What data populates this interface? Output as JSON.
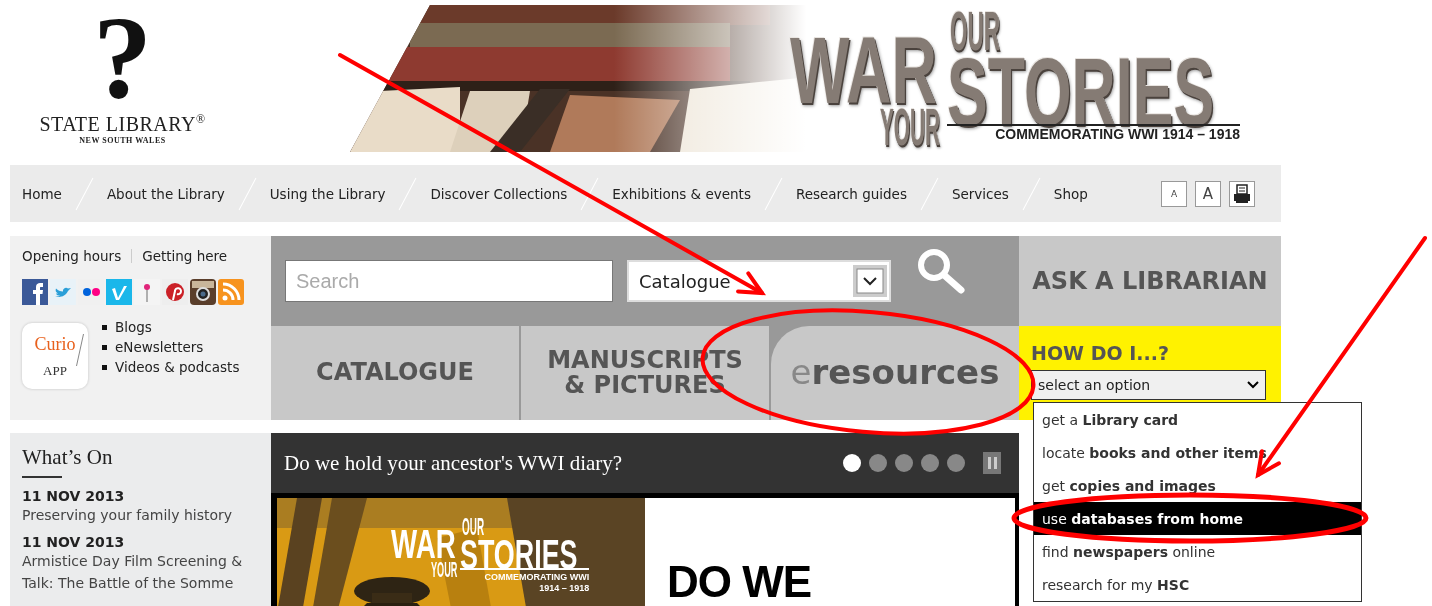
{
  "header": {
    "logo": {
      "mark": "?",
      "name": "STATE LIBRARY",
      "registered": "®",
      "subtitle": "NEW SOUTH WALES"
    },
    "banner": {
      "word_1": "WAR",
      "word_2": "YOUR",
      "word_3": "OUR",
      "word_4": "STORIES",
      "tagline": [
        "COMMEMORATING WWI 1914 – 1918"
      ]
    }
  },
  "nav": {
    "items": [
      "Home",
      "About the Library",
      "Using the Library",
      "Discover Collections",
      "Exhibitions & events",
      "Research guides",
      "Services",
      "Shop"
    ],
    "tools": [
      {
        "kind": "text-small",
        "label": "A"
      },
      {
        "kind": "text-large",
        "label": "A"
      },
      {
        "kind": "print"
      }
    ]
  },
  "quick_links": {
    "links": [
      "Opening hours",
      "Getting here"
    ],
    "social": [
      {
        "kind": "facebook"
      },
      {
        "kind": "twitter"
      },
      {
        "kind": "flickr"
      },
      {
        "kind": "vimeo"
      },
      {
        "kind": "pin"
      },
      {
        "kind": "pinterest"
      },
      {
        "kind": "instagram"
      },
      {
        "kind": "rss"
      }
    ],
    "app": {
      "name": "Curio",
      "label": "APP"
    },
    "list": [
      "Blogs",
      "eNewsletters",
      "Videos & podcasts"
    ]
  },
  "search": {
    "placeholder": "Search",
    "scope": "Catalogue"
  },
  "tabs": [
    {
      "kind": "square",
      "lines": [
        "CATALOGUE"
      ]
    },
    {
      "kind": "square",
      "lines": [
        "MANUSCRIPTS",
        "& PICTURES"
      ]
    },
    {
      "kind": "rounded",
      "lines": [
        "e**resources**"
      ]
    }
  ],
  "ask": {
    "label": "ASK A LIBRARIAN"
  },
  "how_do_i": {
    "title": "HOW DO I...?",
    "select": "select an option",
    "options": [
      {
        "label": "get a **Library card**",
        "selected": false
      },
      {
        "label": "locate **books and other items**",
        "selected": false
      },
      {
        "label": "get **copies and images**",
        "selected": false
      },
      {
        "label": "use **databases from home**",
        "selected": true
      },
      {
        "label": "find **newspapers** online",
        "selected": false
      },
      {
        "label": "research for my **HSC**",
        "selected": false
      }
    ]
  },
  "whats_on": {
    "title": "What’s On",
    "events": [
      {
        "date": "11 NOV 2013",
        "title": "Preserving your family history"
      },
      {
        "date": "11 NOV 2013",
        "title": "Armistice Day Film Screening & Talk: The Battle of the Somme"
      }
    ]
  },
  "slideshow": {
    "title": "Do we hold your ancestor's WWI diary?",
    "dots": [
      {
        "selected": true
      },
      {
        "selected": false
      },
      {
        "selected": false
      },
      {
        "selected": false
      },
      {
        "selected": false
      }
    ],
    "slide": {
      "word_1": "WAR",
      "word_2": "YOUR",
      "word_3": "OUR",
      "word_4": "STORIES",
      "tagline": [
        "COMMEMORATING WWI",
        "1914 – 1918"
      ],
      "headline": "DO WE"
    }
  }
}
